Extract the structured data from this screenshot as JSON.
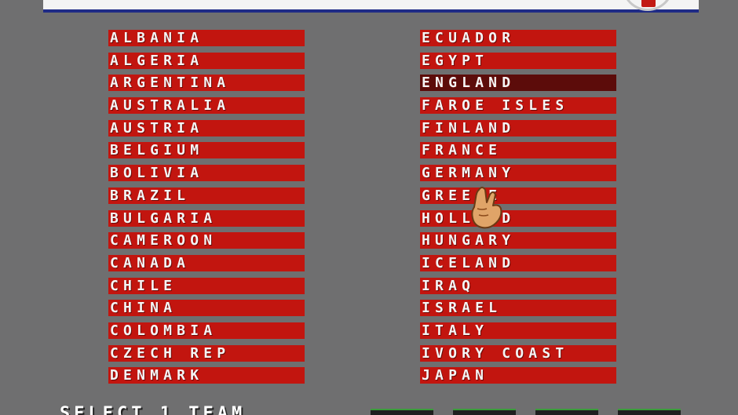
{
  "screen": {
    "prompt": "SELECT 1 TEAM"
  },
  "colors": {
    "background": "#6f6f70",
    "team_bar": "#c2150f",
    "team_bar_selected": "#5c0c0a",
    "banner_stripe": "#1f2b86"
  },
  "teams_left": [
    "ALBANIA",
    "ALGERIA",
    "ARGENTINA",
    "AUSTRALIA",
    "AUSTRIA",
    "BELGIUM",
    "BOLIVIA",
    "BRAZIL",
    "BULGARIA",
    "CAMEROON",
    "CANADA",
    "CHILE",
    "CHINA",
    "COLOMBIA",
    "CZECH REP",
    "DENMARK"
  ],
  "teams_right": [
    "ECUADOR",
    "EGYPT",
    "ENGLAND",
    "FAROE ISLES",
    "FINLAND",
    "FRANCE",
    "GERMANY",
    "GREECE",
    "HOLLAND",
    "HUNGARY",
    "ICELAND",
    "IRAQ",
    "ISRAEL",
    "ITALY",
    "IVORY COAST",
    "JAPAN"
  ],
  "selected_team": "ENGLAND",
  "cursor_icon": "pointing-hand-icon"
}
